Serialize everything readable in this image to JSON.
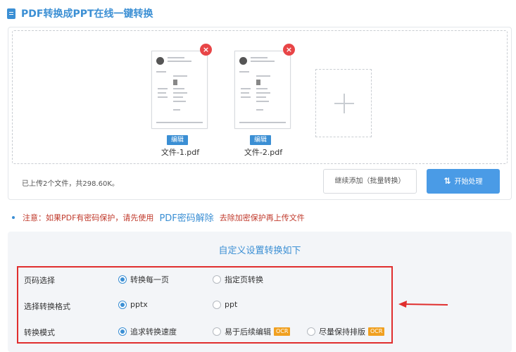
{
  "header": {
    "title": "PDF转换成PPT在线一键转换",
    "icon": "document-icon",
    "accent": "#3b8fd4"
  },
  "upload": {
    "files": [
      {
        "name": "文件-1.pdf",
        "edit_label": "编辑",
        "remove_label": "×"
      },
      {
        "name": "文件-2.pdf",
        "edit_label": "编辑",
        "remove_label": "×"
      }
    ],
    "add_tile": "plus-icon",
    "status": "已上传2个文件，共298.60K。",
    "add_more_label": "继续添加（批量转换）",
    "start_label": "开始处理",
    "start_icon": "⇅"
  },
  "notice": {
    "prefix": "注意：如果PDF有密码保护，请先使用",
    "link": "PDF密码解除",
    "suffix": "去除加密保护再上传文件",
    "color": "#c0392b"
  },
  "settings": {
    "title": "自定义设置转换如下",
    "rows": [
      {
        "label": "页码选择",
        "options": [
          {
            "label": "转换每一页",
            "selected": true
          },
          {
            "label": "指定页转换",
            "selected": false
          }
        ]
      },
      {
        "label": "选择转换格式",
        "options": [
          {
            "label": "pptx",
            "selected": true
          },
          {
            "label": "ppt",
            "selected": false
          }
        ]
      },
      {
        "label": "转换模式",
        "options": [
          {
            "label": "追求转换速度",
            "selected": true
          },
          {
            "label": "易于后续编辑",
            "selected": false,
            "badge": "OCR"
          },
          {
            "label": "尽量保持排版",
            "selected": false,
            "badge": "OCR"
          }
        ]
      }
    ],
    "highlight_color": "#e02e2e"
  }
}
